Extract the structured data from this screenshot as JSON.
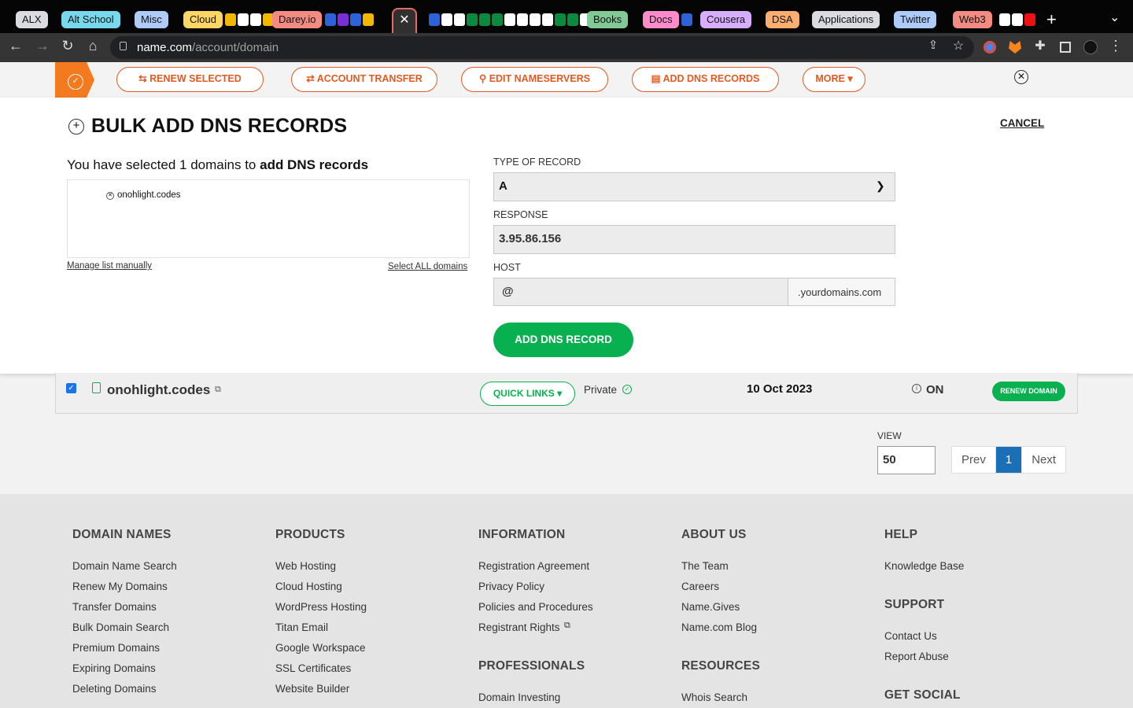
{
  "browser": {
    "tab_groups": [
      {
        "label": "ALX",
        "color": "#dadce0"
      },
      {
        "label": "Alt School",
        "color": "#78d9ec"
      },
      {
        "label": "Misc",
        "color": "#aecbfa"
      },
      {
        "label": "Cloud",
        "color": "#fdd663"
      },
      {
        "label": "Darey.io",
        "color": "#f28b82"
      },
      {
        "label": "Books",
        "color": "#81c995"
      },
      {
        "label": "Docs",
        "color": "#ff8bcb"
      },
      {
        "label": "Cousera",
        "color": "#d7aefb"
      },
      {
        "label": "DSA",
        "color": "#fcad70"
      },
      {
        "label": "Applications",
        "color": "#dadce0"
      },
      {
        "label": "Twitter",
        "color": "#aecbfa"
      },
      {
        "label": "Web3",
        "color": "#f28b82"
      }
    ],
    "active_tab_icon": "close-icon",
    "url_host": "name.com",
    "url_path": "/account/domain"
  },
  "actions": {
    "renew_selected": "RENEW SELECTED",
    "account_transfer": "ACCOUNT TRANSFER",
    "edit_nameservers": "EDIT NAMESERVERS",
    "add_dns_records": "ADD DNS RECORDS",
    "more": "MORE ▾"
  },
  "panel": {
    "title": "BULK ADD DNS RECORDS",
    "cancel": "CANCEL",
    "selected_prefix": "You have selected 1 domains to",
    "selected_bold": "add DNS records",
    "selected_domains": [
      "onohlight.codes"
    ],
    "manage_link": "Manage list manually",
    "select_all_link": "Select ALL domains",
    "type_label": "TYPE OF RECORD",
    "type_value": "A",
    "response_label": "RESPONSE",
    "response_value": "3.95.86.156",
    "host_label": "HOST",
    "host_value": "@",
    "host_suffix": ".yourdomains.com",
    "add_button": "ADD DNS RECORD"
  },
  "domain_row": {
    "checked": true,
    "name": "onohlight.codes",
    "quick_links": "QUICK LINKS ▾",
    "privacy": "Private",
    "expiry": "10 Oct 2023",
    "autorenew": "ON",
    "renew_button": "RENEW DOMAIN"
  },
  "pagination": {
    "view_label": "VIEW",
    "view_value": "50",
    "prev": "Prev",
    "current": "1",
    "next": "Next"
  },
  "footer": {
    "domain_names": {
      "heading": "DOMAIN NAMES",
      "links": [
        "Domain Name Search",
        "Renew My Domains",
        "Transfer Domains",
        "Bulk Domain Search",
        "Premium Domains",
        "Expiring Domains",
        "Deleting Domains"
      ]
    },
    "products": {
      "heading": "PRODUCTS",
      "links": [
        "Web Hosting",
        "Cloud Hosting",
        "WordPress Hosting",
        "Titan Email",
        "Google Workspace",
        "SSL Certificates",
        "Website Builder"
      ]
    },
    "information": {
      "heading": "INFORMATION",
      "links": [
        "Registration Agreement",
        "Privacy Policy",
        "Policies and Procedures",
        "Registrant Rights"
      ]
    },
    "professionals": {
      "heading": "PROFESSIONALS",
      "links": [
        "Domain Investing"
      ]
    },
    "about_us": {
      "heading": "ABOUT US",
      "links": [
        "The Team",
        "Careers",
        "Name.Gives",
        "Name.com Blog"
      ]
    },
    "resources": {
      "heading": "RESOURCES",
      "links": [
        "Whois Search"
      ]
    },
    "help": {
      "heading": "HELP",
      "links": [
        "Knowledge Base"
      ]
    },
    "support": {
      "heading": "SUPPORT",
      "links": [
        "Contact Us",
        "Report Abuse"
      ]
    },
    "social": {
      "heading": "GET SOCIAL"
    }
  },
  "colors": {
    "brand_orange": "#e4591f",
    "brand_green": "#08b050",
    "pager_blue": "#1b6fb5"
  }
}
